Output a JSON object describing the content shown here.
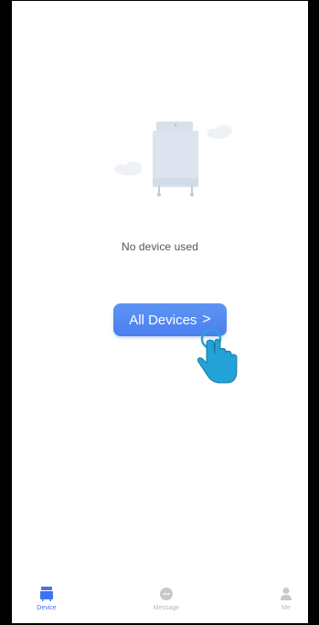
{
  "empty_state": {
    "message": "No device used"
  },
  "button": {
    "label": "All Devices",
    "chevron": ">"
  },
  "tabs": [
    {
      "label": "Device",
      "icon": "device-icon",
      "active": true
    },
    {
      "label": "Message",
      "icon": "message-icon",
      "active": false
    },
    {
      "label": "Me",
      "icon": "person-icon",
      "active": false
    }
  ],
  "colors": {
    "accent": "#4a7ef0",
    "inactive": "#b9b9b9",
    "illustration": "#dfe6f1"
  }
}
